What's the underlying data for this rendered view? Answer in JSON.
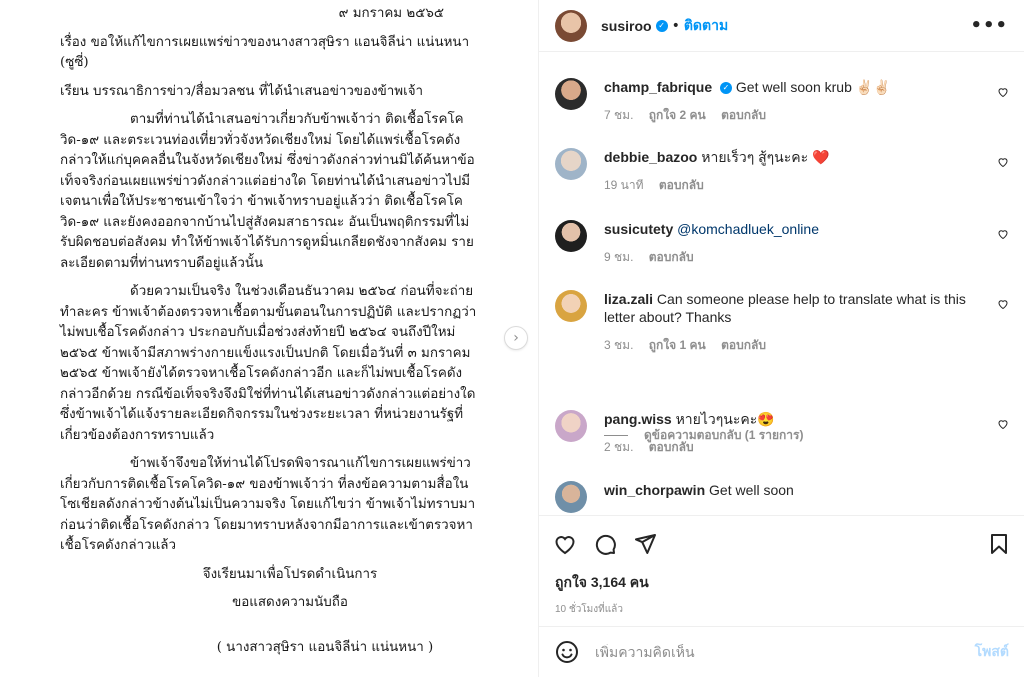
{
  "letter": {
    "date": "๙ มกราคม ๒๕๖๕",
    "subject": "เรื่อง  ขอให้แก้ไขการเผยแพร่ข่าวของนางสาวสุษิรา แอนจิลีน่า แน่นหนา (ซูซี่)",
    "to": "เรียน  บรรณาธิการข่าว/สื่อมวลชน ที่ได้นำเสนอข่าวของข้าพเจ้า",
    "para1": "ตามที่ท่านได้นำเสนอข่าวเกี่ยวกับข้าพเจ้าว่า ติดเชื้อโรคโควิด-๑๙ และตระเวนท่องเที่ยวทั่วจังหวัดเชียงใหม่  โดยได้แพร่เชื้อโรคดังกล่าวให้แก่บุคคลอื่นในจังหวัดเชียงใหม่  ซึ่งข่าวดังกล่าวท่านมิได้ค้นหาข้อเท็จจริงก่อนเผยแพร่ข่าวดังกล่าวแต่อย่างใด  โดยท่านได้นำเสนอข่าวไปมีเจตนาเพื่อให้ประชาชนเข้าใจว่า ข้าพเจ้าทราบอยู่แล้วว่า ติดเชื้อโรคโควิด-๑๙ และยังคงออกจากบ้านไปสู่สังคมสาธารณะ อันเป็นพฤติกรรมที่ไม่รับผิดชอบต่อสังคม ทำให้ข้าพเจ้าได้รับการดูหมิ่นเกลียดชังจากสังคม รายละเอียดตามที่ท่านทราบดีอยู่แล้วนั้น",
    "para2": "ด้วยความเป็นจริง ในช่วงเดือนธันวาคม ๒๕๖๔ ก่อนที่จะถ่ายทำละคร ข้าพเจ้าต้องตรวจหาเชื้อตามขั้นตอนในการปฏิบัติ และปรากฏว่าไม่พบเชื้อโรคดังกล่าว  ประกอบกับเมื่อช่วงส่งท้ายปี ๒๕๖๔ จนถึงปีใหม่ ๒๕๖๕  ข้าพเจ้ามีสภาพร่างกายแข็งแรงเป็นปกติ  โดยเมื่อวันที่ ๓ มกราคม ๒๕๖๕ ข้าพเจ้ายังได้ตรวจหาเชื้อโรคดังกล่าวอีก และก็ไม่พบเชื้อโรคดังกล่าวอีกด้วย  กรณีข้อเท็จจริงจึงมิใช่ที่ท่านได้เสนอข่าวดังกล่าวแต่อย่างใด  ซึ่งข้าพเจ้าได้แจ้งรายละเอียดกิจกรรมในช่วงระยะเวลา  ที่หน่วยงานรัฐที่เกี่ยวข้องต้องการทราบแล้ว",
    "para3": "ข้าพเจ้าจึงขอให้ท่านได้โปรดพิจารณาแก้ไขการเผยแพร่ข่าวเกี่ยวกับการติดเชื้อโรคโควิด-๑๙ ของข้าพเจ้าว่า ที่ลงข้อความตามสื่อในโซเชียลดังกล่าวข้างต้นไม่เป็นความจริง  โดยแก้ไขว่า  ข้าพเจ้าไม่ทราบมาก่อนว่าติดเชื้อโรคดังกล่าว  โดยมาทราบหลังจากมีอาการและเข้าตรวจหาเชื้อโรคดังกล่าวแล้ว",
    "closing1": "จึงเรียนมาเพื่อโปรดดำเนินการ",
    "closing2": "ขอแสดงความนับถือ",
    "signature": "( นางสาวสุษิรา แอนจิลีน่า แน่นหนา )"
  },
  "header": {
    "username": "susiroo",
    "separator": "•",
    "follow_label": "ติดตาม",
    "more_label": "•••"
  },
  "comments": [
    {
      "username": "champ_fabrique",
      "verified": true,
      "text": "Get well soon krub ✌🏻✌🏻",
      "time": "7 ชม.",
      "likes": "ถูกใจ 2 คน",
      "reply": "ตอบกลับ"
    },
    {
      "username": "debbie_bazoo",
      "text": "หายเร็วๆ สู้ๆนะคะ ❤️",
      "time": "19 นาที",
      "reply": "ตอบกลับ"
    },
    {
      "username": "susicutety",
      "text": "@komchadluek_online",
      "time": "9 ชม.",
      "reply": "ตอบกลับ"
    },
    {
      "username": "liza.zali",
      "text": "Can someone please help to translate what is this letter about? Thanks",
      "time": "3 ชม.",
      "likes": "ถูกใจ 1 คน",
      "reply": "ตอบกลับ"
    },
    {
      "username": "pang.wiss",
      "text": "หายไวๆนะคะ😍",
      "time": "2 ชม.",
      "reply": "ตอบกลับ"
    },
    {
      "username": "win_chorpawin",
      "text": "Get well soon"
    }
  ],
  "view_replies": "ดูข้อความตอบกลับ (1 รายการ)",
  "post": {
    "likes": "ถูกใจ 3,164 คน",
    "time_ago": "10 ชั่วโมงที่แล้ว"
  },
  "add_comment": {
    "placeholder": "เพิ่มความคิดเห็น",
    "post_label": "โพสต์"
  },
  "colors": {
    "link_blue": "#0095f6",
    "muted": "#8e8e8e",
    "border": "#efefef",
    "post_disabled": "#b3dbff"
  }
}
